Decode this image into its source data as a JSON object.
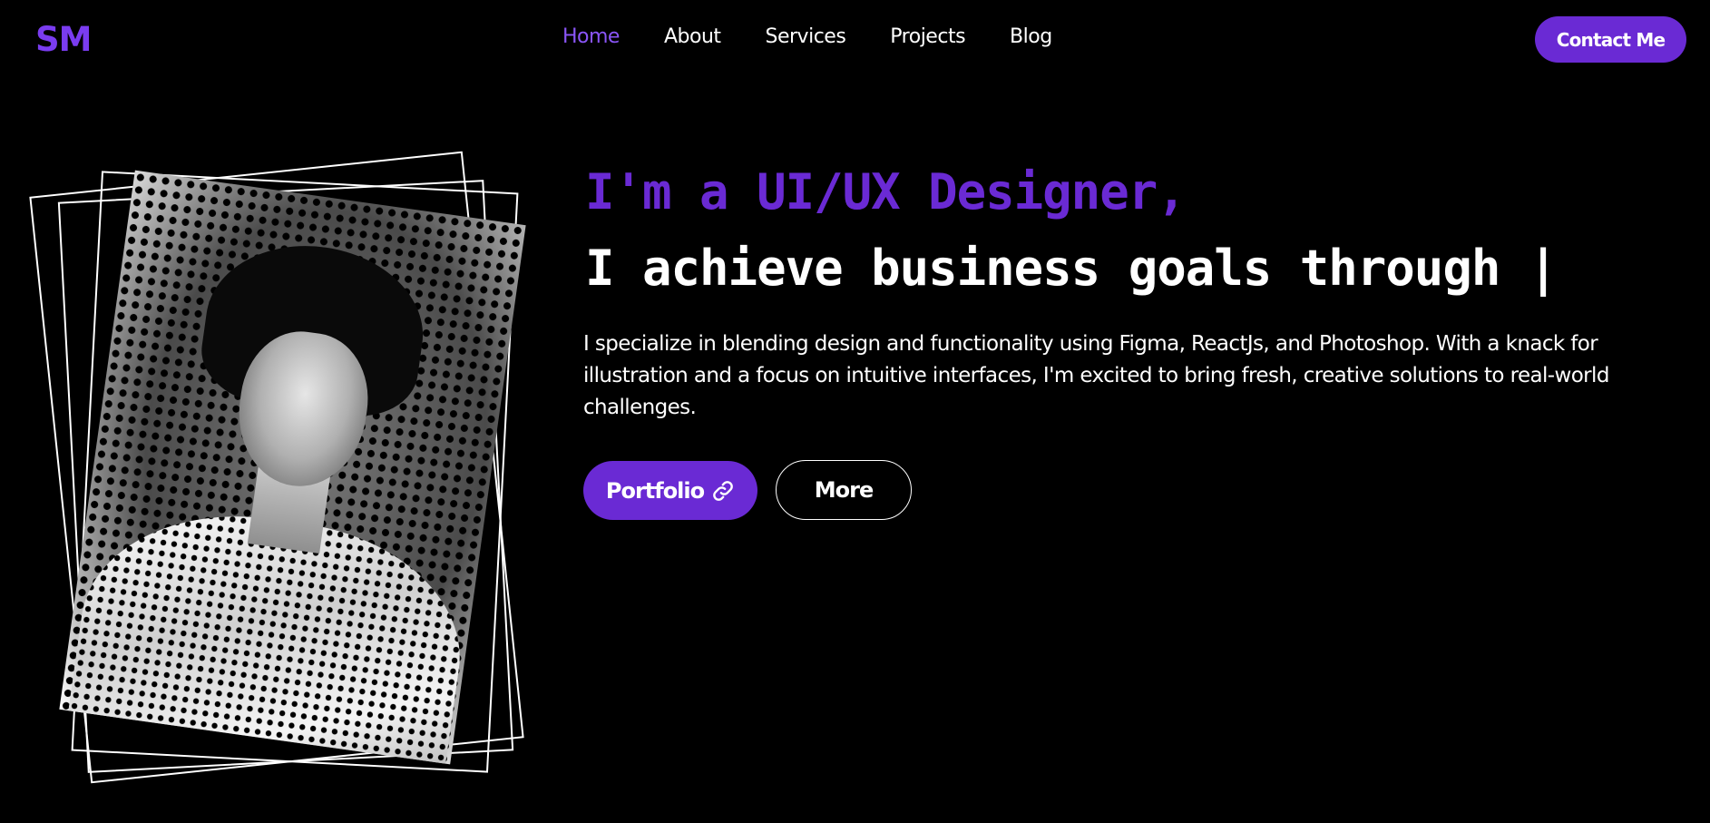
{
  "header": {
    "logo": "SM",
    "nav": [
      {
        "label": "Home",
        "active": true
      },
      {
        "label": "About",
        "active": false
      },
      {
        "label": "Services",
        "active": false
      },
      {
        "label": "Projects",
        "active": false
      },
      {
        "label": "Blog",
        "active": false
      }
    ],
    "contact_label": "Contact Me"
  },
  "hero": {
    "headline_1": "I'm a UI/UX Designer,",
    "headline_2": "I achieve business goals through |",
    "intro": "I specialize in blending design and functionality using Figma, ReactJs, and Photoshop. With a knack for illustration and a focus on intuitive interfaces, I'm excited to bring fresh, creative solutions to real-world challenges.",
    "portfolio_label": "Portfolio",
    "more_label": "More"
  },
  "icons": {
    "portfolio_icon": "link-icon"
  },
  "colors": {
    "background": "#000000",
    "accent": "#6a2ad4",
    "nav_active": "#8a55f7",
    "text": "#ffffff"
  }
}
